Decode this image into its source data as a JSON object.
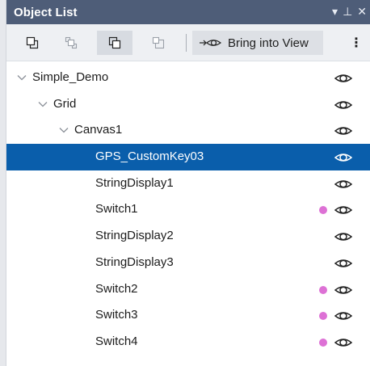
{
  "panel": {
    "title": "Object List"
  },
  "title_controls": {
    "dropdown": "▾",
    "pin": "⊥",
    "close": "✕"
  },
  "toolbar": {
    "bring_into_view_label": "Bring into View",
    "more": "⋮"
  },
  "tree": {
    "items": [
      {
        "label": "Simple_Demo",
        "depth": 0,
        "expandable": true,
        "selected": false,
        "has_dot": false
      },
      {
        "label": "Grid",
        "depth": 1,
        "expandable": true,
        "selected": false,
        "has_dot": false
      },
      {
        "label": "Canvas1",
        "depth": 2,
        "expandable": true,
        "selected": false,
        "has_dot": false
      },
      {
        "label": "GPS_CustomKey03",
        "depth": 3,
        "expandable": false,
        "selected": true,
        "has_dot": false
      },
      {
        "label": "StringDisplay1",
        "depth": 3,
        "expandable": false,
        "selected": false,
        "has_dot": false
      },
      {
        "label": "Switch1",
        "depth": 3,
        "expandable": false,
        "selected": false,
        "has_dot": true
      },
      {
        "label": "StringDisplay2",
        "depth": 3,
        "expandable": false,
        "selected": false,
        "has_dot": false
      },
      {
        "label": "StringDisplay3",
        "depth": 3,
        "expandable": false,
        "selected": false,
        "has_dot": false
      },
      {
        "label": "Switch2",
        "depth": 3,
        "expandable": false,
        "selected": false,
        "has_dot": true
      },
      {
        "label": "Switch3",
        "depth": 3,
        "expandable": false,
        "selected": false,
        "has_dot": true
      },
      {
        "label": "Switch4",
        "depth": 3,
        "expandable": false,
        "selected": false,
        "has_dot": true
      }
    ]
  },
  "colors": {
    "titlebar": "#4e5d78",
    "selection": "#0a5eab",
    "status_dot": "#dd71d5"
  }
}
